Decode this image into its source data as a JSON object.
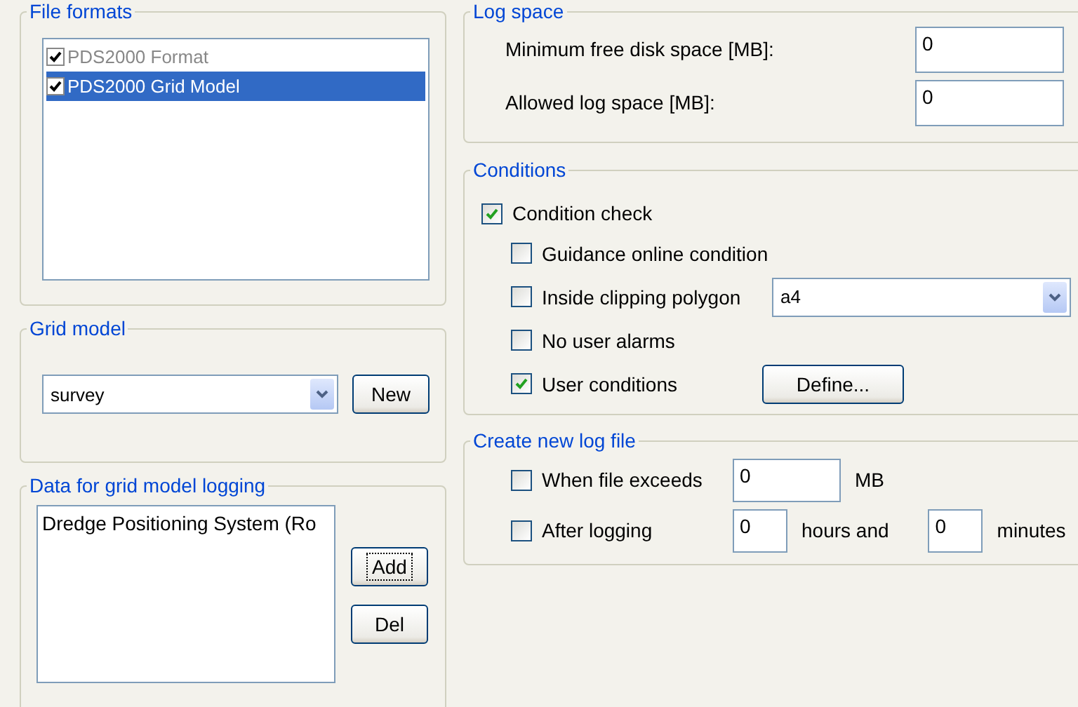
{
  "file_formats": {
    "title": "File formats",
    "items": [
      {
        "label": "PDS2000 Format",
        "checked": true,
        "disabled": true,
        "selected": false
      },
      {
        "label": "PDS2000 Grid Model",
        "checked": true,
        "disabled": false,
        "selected": true
      }
    ]
  },
  "grid_model": {
    "title": "Grid model",
    "combo": {
      "value": "survey"
    },
    "buttons": [
      {
        "label": "New",
        "focused": false
      }
    ]
  },
  "grid_logging": {
    "title": "Data for grid model logging",
    "items": [
      {
        "label": "Dredge Positioning System (Ro",
        "selected": false
      }
    ],
    "buttons": [
      {
        "label": "Add",
        "focused": true
      },
      {
        "label": "Del",
        "focused": false
      }
    ]
  },
  "log_space": {
    "title": "Log space",
    "fields": [
      {
        "label": "Minimum free disk space [MB]:",
        "value": "0"
      },
      {
        "label": "Allowed log space [MB]:",
        "value": "0"
      }
    ]
  },
  "conditions": {
    "title": "Conditions",
    "condition_check": {
      "label": "Condition check",
      "checked": true,
      "children": [
        {
          "kind": "plain",
          "label": "Guidance online condition",
          "checked": false
        },
        {
          "kind": "combo",
          "label": "Inside clipping polygon",
          "checked": false,
          "value": "a4"
        },
        {
          "kind": "plain",
          "label": "No user alarms",
          "checked": false
        },
        {
          "kind": "button",
          "label": "User conditions",
          "checked": true,
          "button": "Define..."
        }
      ]
    }
  },
  "new_log_file": {
    "title": "Create new log file",
    "rows": [
      {
        "label": "When file exceeds",
        "checked": false,
        "parts": [
          {
            "kind": "widefield",
            "value": "0"
          },
          {
            "kind": "text",
            "text": "MB"
          }
        ]
      },
      {
        "label": "After logging",
        "checked": false,
        "parts": [
          {
            "kind": "field",
            "value": "0"
          },
          {
            "kind": "text",
            "text": "hours and"
          },
          {
            "kind": "field",
            "value": "0"
          },
          {
            "kind": "text",
            "text": "minutes"
          }
        ]
      }
    ]
  }
}
